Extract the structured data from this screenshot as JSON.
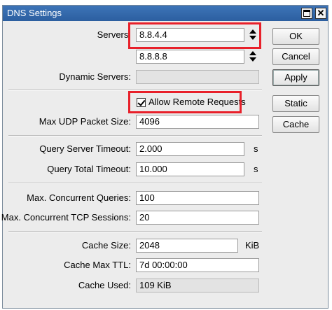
{
  "window": {
    "title": "DNS Settings"
  },
  "fields": {
    "servers": {
      "label": "Servers:",
      "values": [
        "8.8.4.4",
        "8.8.8.8"
      ]
    },
    "dynamic_servers": {
      "label": "Dynamic Servers:",
      "value": ""
    },
    "allow_remote": {
      "label": "Allow Remote Requests",
      "checked": true
    },
    "max_udp": {
      "label": "Max UDP Packet Size:",
      "value": "4096"
    },
    "query_server_timeout": {
      "label": "Query Server Timeout:",
      "value": "2.000",
      "unit": "s"
    },
    "query_total_timeout": {
      "label": "Query Total Timeout:",
      "value": "10.000",
      "unit": "s"
    },
    "max_concurrent_queries": {
      "label": "Max. Concurrent Queries:",
      "value": "100"
    },
    "max_concurrent_tcp": {
      "label": "Max. Concurrent TCP Sessions:",
      "value": "20"
    },
    "cache_size": {
      "label": "Cache Size:",
      "value": "2048",
      "unit": "KiB"
    },
    "cache_max_ttl": {
      "label": "Cache Max TTL:",
      "value": "7d 00:00:00"
    },
    "cache_used": {
      "label": "Cache Used:",
      "value": "109 KiB"
    }
  },
  "buttons": {
    "ok": "OK",
    "cancel": "Cancel",
    "apply": "Apply",
    "static": "Static",
    "cache": "Cache"
  },
  "colors": {
    "titlebar": "#2c5fa0",
    "highlight": "#e8202a",
    "window_bg": "#ececec"
  }
}
